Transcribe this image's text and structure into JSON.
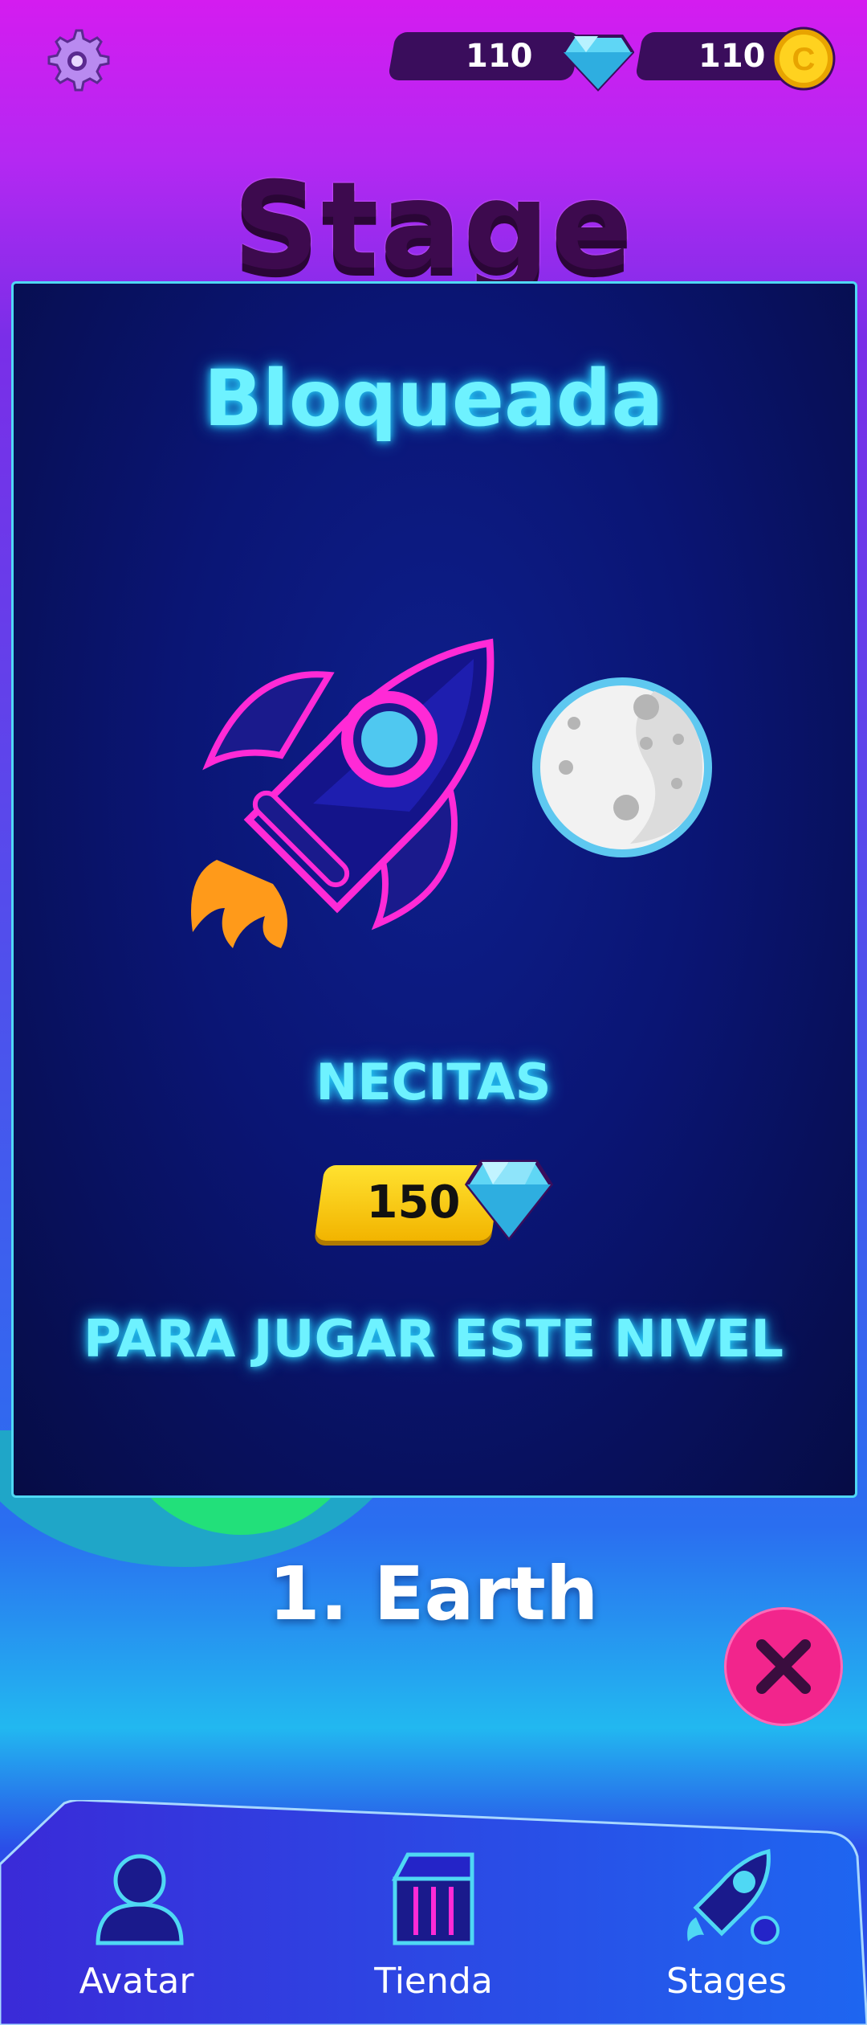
{
  "header": {
    "gems": "110",
    "coins": "110",
    "title": "Stage"
  },
  "panel": {
    "status": "Bloqueada",
    "need_label": "NECITAS",
    "cost": "150",
    "play_label": "PARA JUGAR ESTE NIVEL"
  },
  "stage": {
    "name": "1. Earth"
  },
  "nav": {
    "items": [
      {
        "label": "Avatar",
        "icon": "avatar-icon"
      },
      {
        "label": "Tienda",
        "icon": "shop-icon"
      },
      {
        "label": "Stages",
        "icon": "rocket-icon"
      }
    ]
  },
  "colors": {
    "neon": "#6ef2ff",
    "accent_pink": "#f2258c",
    "gold": "#ffd21f"
  }
}
